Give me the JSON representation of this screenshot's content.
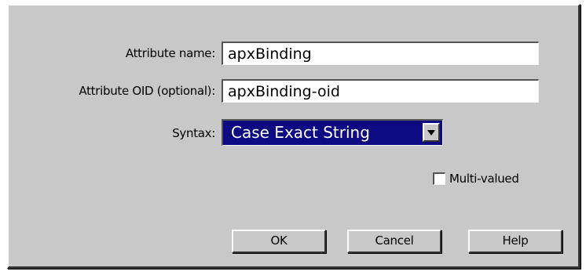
{
  "form": {
    "attribute_name": {
      "label": "Attribute name:",
      "value": "apxBinding"
    },
    "attribute_oid": {
      "label": "Attribute OID (optional):",
      "value": "apxBinding-oid"
    },
    "syntax": {
      "label": "Syntax:",
      "selected": "Case Exact String"
    },
    "multi_valued": {
      "label": "Multi-valued",
      "checked": false
    }
  },
  "buttons": {
    "ok": "OK",
    "cancel": "Cancel",
    "help": "Help"
  },
  "colors": {
    "dialog_background": "#c8c8c8",
    "selection_highlight": "#0e0a82",
    "field_background": "#ffffff"
  }
}
